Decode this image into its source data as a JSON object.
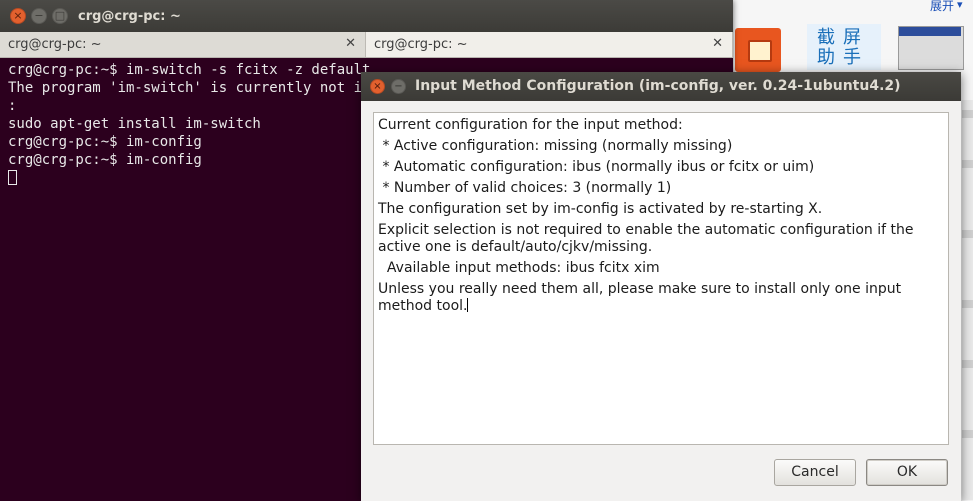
{
  "background": {
    "top_link": "展开",
    "chinese_chars": "截屏助手"
  },
  "terminal": {
    "title": "crg@crg-pc: ~",
    "tabs": [
      {
        "label": "crg@crg-pc: ~",
        "active": false
      },
      {
        "label": "crg@crg-pc: ~",
        "active": true
      }
    ],
    "lines": [
      "crg@crg-pc:~$ im-switch -s fcitx -z default",
      "The program 'im-switch' is currently not installed.",
      ":",
      "sudo apt-get install im-switch",
      "crg@crg-pc:~$ im-config",
      "crg@crg-pc:~$ im-config"
    ]
  },
  "dialog": {
    "title": "Input Method Configuration (im-config, ver. 0.24-1ubuntu4.2)",
    "text_lines": [
      "Current configuration for the input method:",
      " * Active configuration: missing (normally missing)",
      " * Automatic configuration: ibus (normally ibus or fcitx or uim)",
      " * Number of valid choices: 3 (normally 1)",
      "The configuration set by im-config is activated by re-starting X.",
      "Explicit selection is not required to enable the automatic configuration if the active one is default/auto/cjkv/missing.",
      "  Available input methods: ibus fcitx xim",
      "Unless you really need them all, please make sure to install only one input method tool."
    ],
    "cancel_label": "Cancel",
    "ok_label": "OK"
  },
  "colors": {
    "terminal_bg": "#2c001e",
    "titlebar": "#3c3b37",
    "close_button": "#e2602e"
  }
}
